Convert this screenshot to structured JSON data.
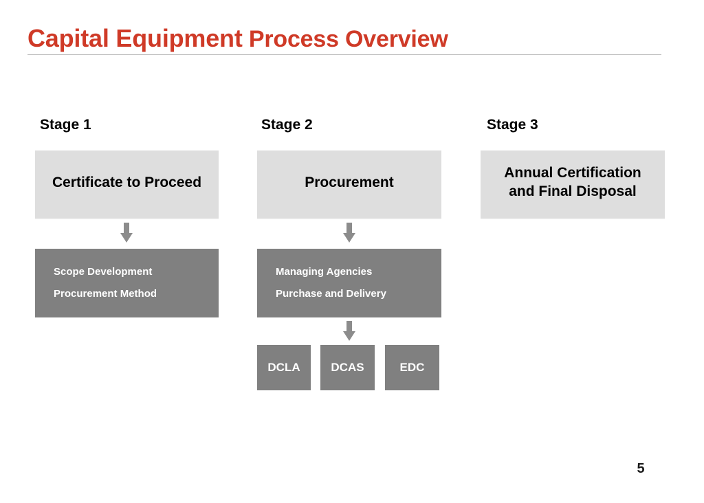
{
  "slide": {
    "title_lead": "Capital Equipment",
    "title_rest": " Process Overview",
    "title_full": "Capital Equipment Process Overview",
    "title_color": "#CF3A27",
    "page_number": "5",
    "background": "#FFFFFF"
  },
  "colors": {
    "title_red": "#CF3A27",
    "box_light": "#DEDEDE",
    "box_dark": "#808080",
    "rule": "#BFBFBF",
    "arrow": "#8C8C8C",
    "text_dark": "#000000",
    "text_light": "#FFFFFF"
  },
  "stages": [
    {
      "label": "Stage 1",
      "primary_box": {
        "text": "Certificate to Proceed",
        "style": "light"
      },
      "detail_box": {
        "style": "dark",
        "lines": [
          "Scope Development",
          "Procurement Method"
        ]
      },
      "has_arrow_to_detail": true
    },
    {
      "label": "Stage 2",
      "primary_box": {
        "text": "Procurement",
        "style": "light"
      },
      "detail_box": {
        "style": "dark",
        "lines": [
          "Managing Agencies",
          "Purchase and Delivery"
        ]
      },
      "has_arrow_to_detail": true,
      "agencies": [
        {
          "label": "DCLA"
        },
        {
          "label": "DCAS"
        },
        {
          "label": "EDC"
        }
      ]
    },
    {
      "label": "Stage 3",
      "primary_box": {
        "style": "light",
        "lines": [
          "Annual Certification",
          "and Final Disposal"
        ]
      },
      "has_arrow_to_detail": false
    }
  ],
  "icons": {
    "arrow_down": "down-arrow-icon"
  }
}
